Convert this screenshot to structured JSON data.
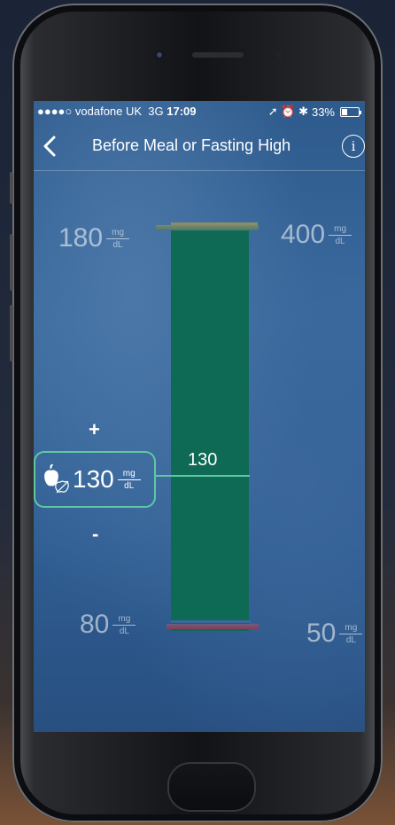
{
  "status_bar": {
    "signal": "●●●●○",
    "carrier": "vodafone UK",
    "network": "3G",
    "time": "17:09",
    "indicators": "➚ ⏰ ✱",
    "battery_percent": "33%"
  },
  "nav": {
    "back_icon": "chevron-left-icon",
    "title": "Before Meal or Fasting High",
    "info_icon": "info-icon"
  },
  "slider": {
    "upper_left_value": "180",
    "upper_right_value": "400",
    "lower_left_value": "80",
    "lower_right_value": "50",
    "unit_top": "mg",
    "unit_bottom": "dL",
    "marker_value": "130",
    "increase_label": "+",
    "decrease_label": "-",
    "current_value": "130",
    "meal_icon": "apple-meal-icon",
    "colors": {
      "bar": "#0e6a55",
      "marker": "#5cc8a0"
    }
  }
}
